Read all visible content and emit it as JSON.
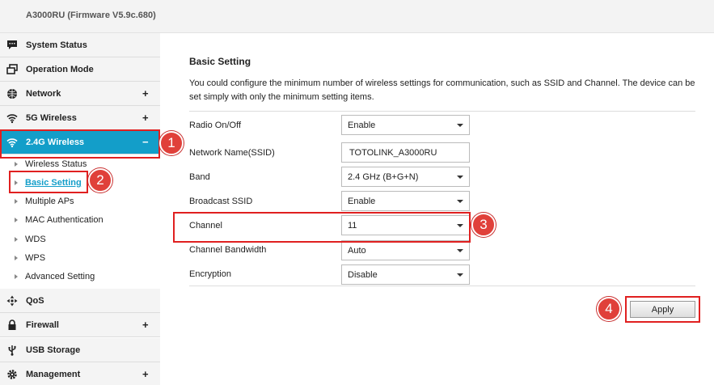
{
  "header": {
    "title": "A3000RU (Firmware V5.9c.680)"
  },
  "sidebar": {
    "menus": [
      {
        "label": "System Status",
        "icon": "chat-icon",
        "expand": ""
      },
      {
        "label": "Operation Mode",
        "icon": "windows-icon",
        "expand": ""
      },
      {
        "label": "Network",
        "icon": "globe-icon",
        "expand": "+"
      },
      {
        "label": "5G Wireless",
        "icon": "wifi-icon",
        "expand": "+"
      },
      {
        "label": "2.4G Wireless",
        "icon": "wifi-icon",
        "expand": "−"
      },
      {
        "label": "QoS",
        "icon": "qos-icon",
        "expand": ""
      },
      {
        "label": "Firewall",
        "icon": "lock-icon",
        "expand": "+"
      },
      {
        "label": "USB Storage",
        "icon": "usb-icon",
        "expand": ""
      },
      {
        "label": "Management",
        "icon": "gear-icon",
        "expand": "+"
      }
    ],
    "submenu": [
      "Wireless Status",
      "Basic Setting",
      "Multiple APs",
      "MAC Authentication",
      "WDS",
      "WPS",
      "Advanced Setting"
    ]
  },
  "main": {
    "title": "Basic Setting",
    "description": "You could configure the minimum number of wireless settings for communication, such as SSID and Channel. The device can be set simply with only the minimum setting items.",
    "fields": {
      "radio": {
        "label": "Radio On/Off",
        "value": "Enable"
      },
      "ssid": {
        "label": "Network Name(SSID)",
        "value": "TOTOLINK_A3000RU"
      },
      "band": {
        "label": "Band",
        "value": "2.4 GHz (B+G+N)"
      },
      "broadcast": {
        "label": "Broadcast SSID",
        "value": "Enable"
      },
      "channel": {
        "label": "Channel",
        "value": "11"
      },
      "bandwidth": {
        "label": "Channel Bandwidth",
        "value": "Auto"
      },
      "encryption": {
        "label": "Encryption",
        "value": "Disable"
      }
    },
    "apply_label": "Apply"
  },
  "annotations": [
    "1",
    "2",
    "3",
    "4"
  ],
  "colors": {
    "accent": "#139ec9",
    "highlight": "#e02020",
    "badge": "#e0403a"
  }
}
